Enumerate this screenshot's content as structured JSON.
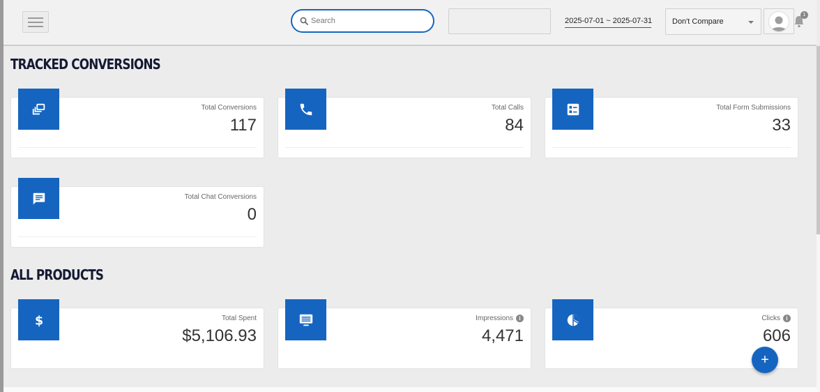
{
  "header": {
    "search_placeholder": "Search",
    "date_range": "2025-07-01 ~ 2025-07-31",
    "compare_selected": "Don't Compare",
    "notification_count": "1"
  },
  "sections": {
    "tracked_conversions": {
      "title": "Tracked Conversions",
      "cards": [
        {
          "label": "Total Conversions",
          "value": "117",
          "icon": "collection-icon"
        },
        {
          "label": "Total Calls",
          "value": "84",
          "icon": "phone-icon"
        },
        {
          "label": "Total Form Submissions",
          "value": "33",
          "icon": "form-list-icon"
        },
        {
          "label": "Total Chat Conversions",
          "value": "0",
          "icon": "chat-icon"
        }
      ]
    },
    "all_products": {
      "title": "All Products",
      "cards": [
        {
          "label": "Total Spent",
          "value": "$5,106.93",
          "icon": "dollar-icon"
        },
        {
          "label": "Impressions",
          "value": "4,471",
          "icon": "monitor-icon",
          "info": "i"
        },
        {
          "label": "Clicks",
          "value": "606",
          "icon": "pie-chart-icon",
          "info": "i"
        }
      ]
    }
  },
  "fab": {
    "label": "+"
  },
  "colors": {
    "accent": "#1565c0",
    "title": "#141a33"
  }
}
